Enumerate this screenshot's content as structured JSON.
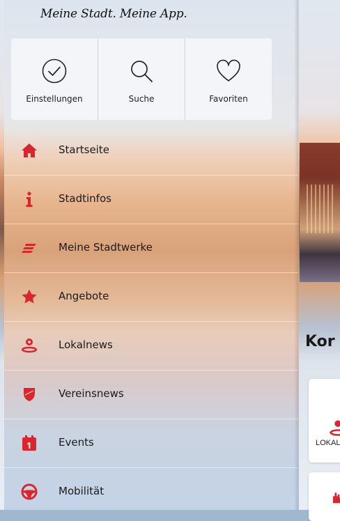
{
  "background": {
    "headline_fragment": "Kor",
    "card_label_fragment": "LOKAL"
  },
  "drawer": {
    "slogan": "Meine Stadt. Meine App.",
    "quick_actions": [
      {
        "label": "Einstellungen",
        "icon": "check-circle-icon"
      },
      {
        "label": "Suche",
        "icon": "search-icon"
      },
      {
        "label": "Favoriten",
        "icon": "heart-icon"
      }
    ],
    "menu": [
      {
        "label": "Startseite",
        "icon": "home-icon"
      },
      {
        "label": "Stadtinfos",
        "icon": "info-icon"
      },
      {
        "label": "Meine Stadtwerke",
        "icon": "stadtwerke-logo-icon"
      },
      {
        "label": "Angebote",
        "icon": "star-icon"
      },
      {
        "label": "Lokalnews",
        "icon": "location-people-icon"
      },
      {
        "label": "Vereinsnews",
        "icon": "shield-icon"
      },
      {
        "label": "Events",
        "icon": "calendar-icon"
      },
      {
        "label": "Mobilität",
        "icon": "steering-wheel-icon"
      }
    ]
  },
  "colors": {
    "accent": "#d9262e",
    "text": "#1b1b1b"
  }
}
